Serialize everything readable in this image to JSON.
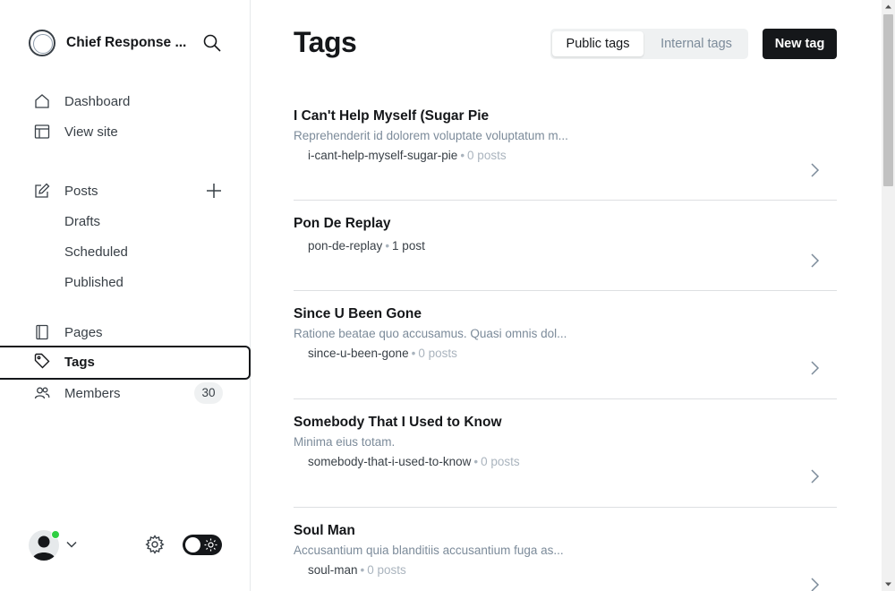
{
  "sidebar": {
    "site_name": "Chief Response ...",
    "nav": {
      "dashboard": "Dashboard",
      "view_site": "View site",
      "posts": "Posts",
      "drafts": "Drafts",
      "scheduled": "Scheduled",
      "published": "Published",
      "pages": "Pages",
      "tags": "Tags",
      "members": "Members"
    },
    "members_count": "30"
  },
  "header": {
    "title": "Tags",
    "tabs": [
      "Public tags",
      "Internal tags"
    ],
    "active_tab": "Public tags",
    "new_tag_label": "New tag"
  },
  "tags": [
    {
      "name": "I Can't Help Myself (Sugar Pie",
      "description": "Reprehenderit id dolorem voluptate voluptatum m...",
      "slug": "i-cant-help-myself-sugar-pie",
      "count": "0 posts"
    },
    {
      "name": "Pon De Replay",
      "description": "",
      "slug": "pon-de-replay",
      "count": "1 post"
    },
    {
      "name": "Since U Been Gone",
      "description": "Ratione beatae quo accusamus. Quasi omnis dol...",
      "slug": "since-u-been-gone",
      "count": "0 posts"
    },
    {
      "name": "Somebody That I Used to Know",
      "description": "Minima eius totam.",
      "slug": "somebody-that-i-used-to-know",
      "count": "0 posts"
    },
    {
      "name": "Soul Man",
      "description": "Accusantium quia blanditiis accusantium fuga as...",
      "slug": "soul-man",
      "count": "0 posts"
    }
  ],
  "colors": {
    "accent_dark": "#15171a",
    "muted_text": "#7c8b9a",
    "online": "#30cf43",
    "divider": "#dddfe2"
  }
}
